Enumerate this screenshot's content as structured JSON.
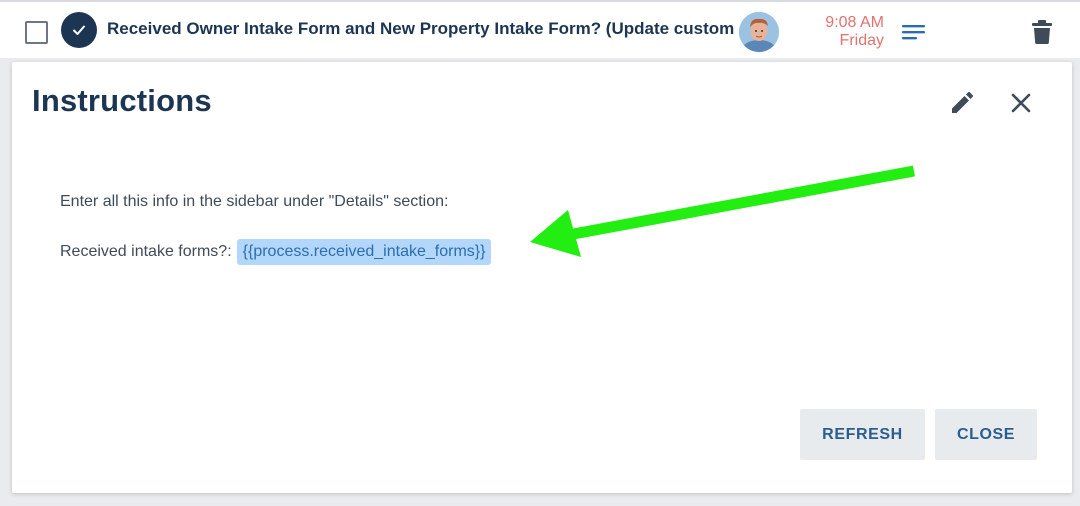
{
  "task": {
    "title": "Received Owner Intake Form and New Property Intake Form? (Update custom fields)",
    "time": "9:08 AM",
    "day": "Friday",
    "checked": true
  },
  "panel": {
    "title": "Instructions",
    "line1": "Enter all this info in the sidebar under \"Details\" section:",
    "line2_label": "Received intake forms?:",
    "line2_variable": "{{process.received_intake_forms}}",
    "refresh_label": "REFRESH",
    "close_label": "CLOSE"
  },
  "colors": {
    "navy": "#1c3553",
    "time": "#e0736e",
    "chip_bg": "#b3d7fb",
    "chip_text": "#2a6db0",
    "annotation_arrow": "#22ee11",
    "button_text": "#2b5d8e"
  },
  "icons": [
    "checkbox-icon",
    "check-circle-icon",
    "avatar",
    "notes-icon",
    "trash-icon",
    "pencil-icon",
    "close-icon",
    "green-arrow-annotation"
  ]
}
